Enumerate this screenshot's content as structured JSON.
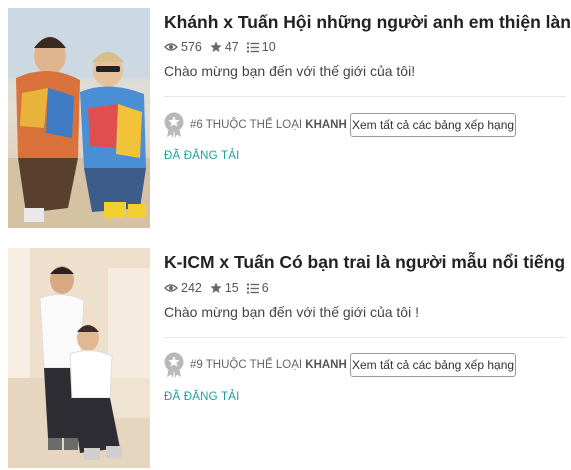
{
  "stories": [
    {
      "title": "Khánh x Tuấn Hội những người anh em thiện lành",
      "views": "576",
      "votes": "47",
      "parts": "10",
      "description": "Chào mừng bạn đến với thế giới của tôi!",
      "rank_number": "#6",
      "rank_middle": " THUỘC THỂ LOẠI ",
      "rank_tag": "KHANH",
      "ranking_button": "Xem tất cả các bảng xếp hạng",
      "status": "ĐÃ ĐĂNG TẢI"
    },
    {
      "title": "K-ICM x Tuấn Có bạn trai là người mẫu nổi tiếng",
      "views": "242",
      "votes": "15",
      "parts": "6",
      "description": "Chào mừng bạn đến với thế giới của tôi !",
      "rank_number": "#9",
      "rank_middle": " THUỘC THỂ LOẠI ",
      "rank_tag": "KHANH",
      "ranking_button": "Xem tất cả các bảng xếp hạng",
      "status": "ĐÃ ĐĂNG TẢI"
    }
  ],
  "icons": {
    "views": "eye-icon",
    "votes": "star-icon",
    "parts": "list-icon",
    "rank": "ribbon-badge-icon"
  },
  "colors": {
    "accent": "#1a9ea3",
    "badge": "#b9b9b9"
  }
}
